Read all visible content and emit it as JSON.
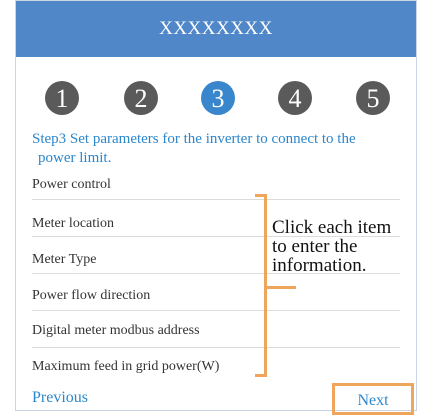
{
  "header": {
    "title": "XXXXXXXX"
  },
  "steps": [
    "1",
    "2",
    "3",
    "4",
    "5"
  ],
  "active_step": 3,
  "description": {
    "line1": "Step3 Set parameters for the inverter to connect to the",
    "line2": "power limit."
  },
  "fields": [
    "Power control",
    "Meter location",
    "Meter Type",
    "Power flow direction",
    "Digital meter modbus address",
    "Maximum feed in grid power(W)"
  ],
  "annotation": {
    "line1": "Click each item",
    "line2": "to enter the",
    "line3": "information."
  },
  "nav": {
    "previous": "Previous",
    "next": "Next"
  },
  "colors": {
    "header": "#4f87c9",
    "accent_blue": "#2b87cc",
    "highlight": "#f0a55c",
    "step_inactive": "#5a5a5a"
  }
}
